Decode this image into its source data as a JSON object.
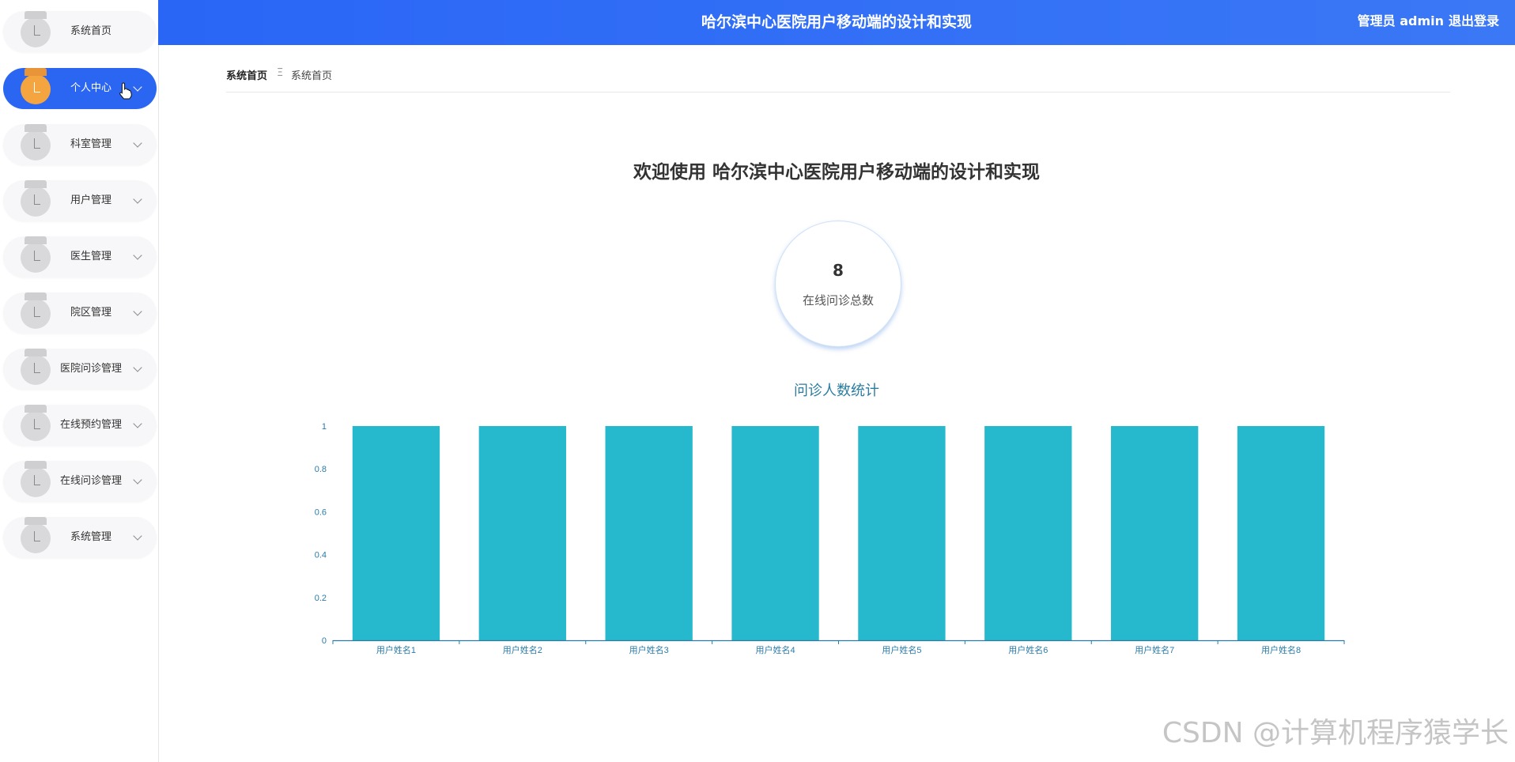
{
  "sidebar": {
    "items": [
      {
        "label": "系统首页"
      },
      {
        "label": "个人中心"
      },
      {
        "label": "科室管理"
      },
      {
        "label": "用户管理"
      },
      {
        "label": "医生管理"
      },
      {
        "label": "院区管理"
      },
      {
        "label": "医院问诊管理"
      },
      {
        "label": "在线预约管理"
      },
      {
        "label": "在线问诊管理"
      },
      {
        "label": "系统管理"
      }
    ]
  },
  "header": {
    "title": "哈尔滨中心医院用户移动端的设计和实现",
    "user": "管理员 admin",
    "logout": "退出登录"
  },
  "breadcrumb": {
    "home": "系统首页",
    "separator": "Ξ",
    "current": "系统首页"
  },
  "main": {
    "welcome": "欢迎使用 哈尔滨中心医院用户移动端的设计和实现",
    "stat": {
      "value": "8",
      "label": "在线问诊总数"
    }
  },
  "chart_data": {
    "type": "bar",
    "title": "问诊人数统计",
    "categories": [
      "用户姓名1",
      "用户姓名2",
      "用户姓名3",
      "用户姓名4",
      "用户姓名5",
      "用户姓名6",
      "用户姓名7",
      "用户姓名8"
    ],
    "values": [
      1,
      1,
      1,
      1,
      1,
      1,
      1,
      1
    ],
    "ylim": [
      0,
      1
    ],
    "yticks": [
      "0",
      "0.2",
      "0.4",
      "0.6",
      "0.8",
      "1"
    ],
    "grid": false,
    "bar_color": "#26b8cc",
    "axis_color": "#2a7ba8"
  },
  "watermark": "CSDN @计算机程序猿学长",
  "colors": {
    "accent": "#2a66f6",
    "active_icon": "#f5a540"
  }
}
